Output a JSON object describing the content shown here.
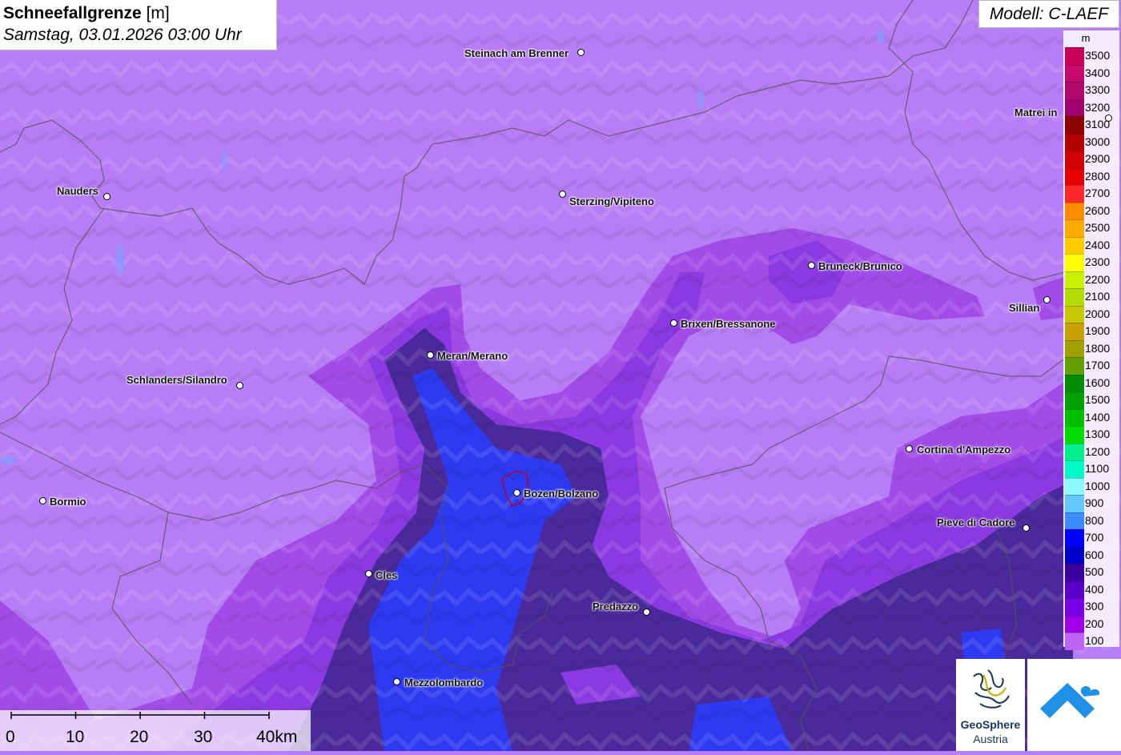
{
  "header": {
    "title_main": "Schneefallgrenze",
    "title_unit": "[m]",
    "subtitle": "Samstag, 03.01.2026 03:00 Uhr",
    "model": "Modell: C-LAEF"
  },
  "legend": {
    "unit": "m",
    "items": [
      {
        "label": "3500",
        "color": "#c8005a"
      },
      {
        "label": "3400",
        "color": "#c80a6e"
      },
      {
        "label": "3300",
        "color": "#b0086c"
      },
      {
        "label": "3200",
        "color": "#a00070"
      },
      {
        "label": "3100",
        "color": "#8c0000"
      },
      {
        "label": "3000",
        "color": "#b40000"
      },
      {
        "label": "2900",
        "color": "#d20000"
      },
      {
        "label": "2800",
        "color": "#e60000"
      },
      {
        "label": "2700",
        "color": "#ff2828"
      },
      {
        "label": "2600",
        "color": "#ff8c00"
      },
      {
        "label": "2500",
        "color": "#ffaa00"
      },
      {
        "label": "2400",
        "color": "#ffcc00"
      },
      {
        "label": "2300",
        "color": "#ffff00"
      },
      {
        "label": "2200",
        "color": "#c8f000"
      },
      {
        "label": "2100",
        "color": "#b4dc00"
      },
      {
        "label": "2000",
        "color": "#c8c800"
      },
      {
        "label": "1900",
        "color": "#c8a000"
      },
      {
        "label": "1800",
        "color": "#a0a000"
      },
      {
        "label": "1700",
        "color": "#64a000"
      },
      {
        "label": "1600",
        "color": "#008c00"
      },
      {
        "label": "1500",
        "color": "#00a000"
      },
      {
        "label": "1400",
        "color": "#00be00"
      },
      {
        "label": "1300",
        "color": "#00dc00"
      },
      {
        "label": "1200",
        "color": "#00f08c"
      },
      {
        "label": "1100",
        "color": "#00fac8"
      },
      {
        "label": "1000",
        "color": "#8cfaff"
      },
      {
        "label": "900",
        "color": "#64c8ff"
      },
      {
        "label": "800",
        "color": "#3c8cff"
      },
      {
        "label": "700",
        "color": "#0000ff"
      },
      {
        "label": "600",
        "color": "#0000c8"
      },
      {
        "label": "500",
        "color": "#3c00a0"
      },
      {
        "label": "400",
        "color": "#5a00c8"
      },
      {
        "label": "300",
        "color": "#7800e6"
      },
      {
        "label": "200",
        "color": "#a000e6"
      },
      {
        "label": "100",
        "color": "#be64f5"
      }
    ]
  },
  "cities": [
    {
      "name": "Steinach am Brenner"
    },
    {
      "name": "Nauders"
    },
    {
      "name": "Sterzing/Vipiteno"
    },
    {
      "name": "Matrei in"
    },
    {
      "name": "Bruneck/Brunico"
    },
    {
      "name": "Sillian"
    },
    {
      "name": "Brixen/Bressanone"
    },
    {
      "name": "Meran/Merano"
    },
    {
      "name": "Schlanders/Silandro"
    },
    {
      "name": "Cortina d'Ampezzo"
    },
    {
      "name": "Bormio"
    },
    {
      "name": "Bozen/Bolzano"
    },
    {
      "name": "Pieve di Cadore"
    },
    {
      "name": "Cles"
    },
    {
      "name": "Predazzo"
    },
    {
      "name": "Mezzolombardo"
    }
  ],
  "scale": {
    "ticks": [
      "0",
      "10",
      "20",
      "30",
      "40km"
    ]
  },
  "logo": {
    "line1": "GeoSphere",
    "line2": "Austria"
  },
  "colors": {
    "background": "#b77df5",
    "zone_200": "#a24ce8",
    "zone_300": "#8a3ae0",
    "zone_500": "#4a2a9a",
    "zone_700": "#2d3af0"
  }
}
